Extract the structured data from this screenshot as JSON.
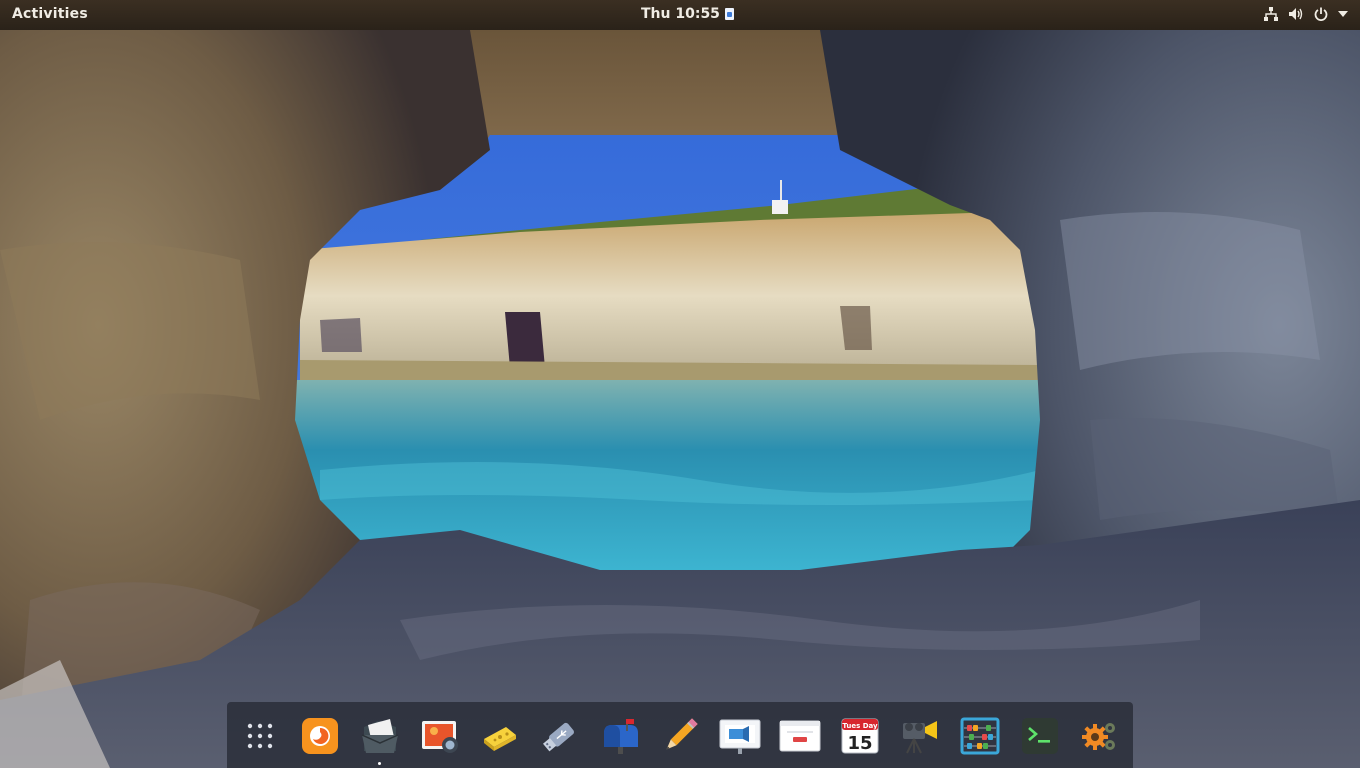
{
  "topbar": {
    "activities_label": "Activities",
    "clock_text": "Thu 10:55",
    "tray_icons": [
      "network-wired-icon",
      "volume-icon",
      "power-icon",
      "chevron-down-icon"
    ]
  },
  "dock": {
    "items": [
      {
        "name": "show-apps",
        "icon": "grid-dots-icon"
      },
      {
        "name": "firefox",
        "icon": "firefox-icon"
      },
      {
        "name": "files",
        "icon": "mail-folder-icon",
        "running": true
      },
      {
        "name": "image-viewer",
        "icon": "photo-icon"
      },
      {
        "name": "cheese",
        "icon": "cheese-icon"
      },
      {
        "name": "usb-creator",
        "icon": "usb-drive-icon"
      },
      {
        "name": "mailbox",
        "icon": "mailbox-icon"
      },
      {
        "name": "text-editor",
        "icon": "pencil-icon"
      },
      {
        "name": "presentation",
        "icon": "presentation-icon"
      },
      {
        "name": "window",
        "icon": "window-icon"
      },
      {
        "name": "calendar",
        "icon": "calendar-icon",
        "day_label": "Tues Day",
        "date": "15"
      },
      {
        "name": "video-recorder",
        "icon": "camera-icon"
      },
      {
        "name": "abacus",
        "icon": "abacus-icon"
      },
      {
        "name": "terminal",
        "icon": "terminal-icon"
      },
      {
        "name": "settings",
        "icon": "gears-icon"
      }
    ]
  },
  "colors": {
    "topbar_bg": "#2f261c",
    "dock_bg": "#262a34",
    "sky": "#3d71e0",
    "water": "#3aa7c4",
    "rock": "#6b5a44"
  }
}
